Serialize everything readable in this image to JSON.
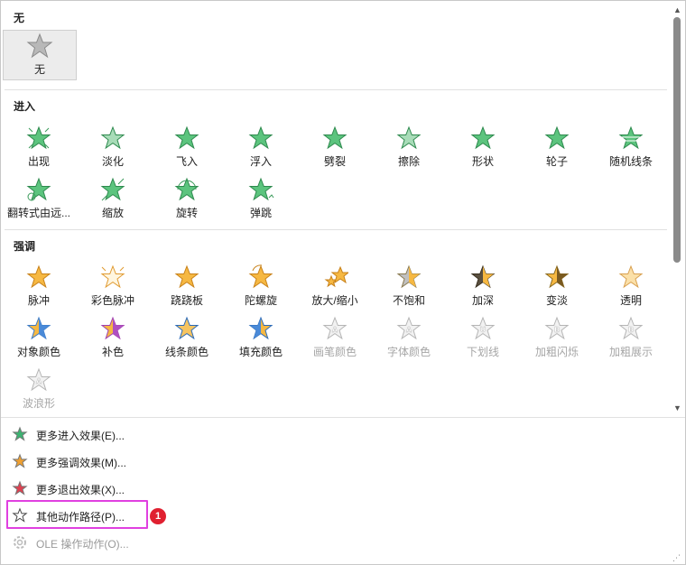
{
  "sections": {
    "none": "无",
    "entrance": "进入",
    "emphasis": "强调"
  },
  "none_item": {
    "label": "无",
    "icon": "star-gray-icon"
  },
  "entrance_items": [
    {
      "label": "出现",
      "icon": "appear-icon"
    },
    {
      "label": "淡化",
      "icon": "fade-icon"
    },
    {
      "label": "飞入",
      "icon": "fly-in-icon"
    },
    {
      "label": "浮入",
      "icon": "float-in-icon"
    },
    {
      "label": "劈裂",
      "icon": "split-icon"
    },
    {
      "label": "擦除",
      "icon": "wipe-icon"
    },
    {
      "label": "形状",
      "icon": "shape-icon"
    },
    {
      "label": "轮子",
      "icon": "wheel-icon"
    },
    {
      "label": "随机线条",
      "icon": "random-bars-icon"
    },
    {
      "label": "翻转式由远...",
      "icon": "grow-turn-icon"
    },
    {
      "label": "缩放",
      "icon": "zoom-icon"
    },
    {
      "label": "旋转",
      "icon": "swivel-icon"
    },
    {
      "label": "弹跳",
      "icon": "bounce-icon"
    }
  ],
  "emphasis_items": [
    {
      "label": "脉冲",
      "icon": "pulse-icon",
      "enabled": true
    },
    {
      "label": "彩色脉冲",
      "icon": "color-pulse-icon",
      "enabled": true
    },
    {
      "label": "跷跷板",
      "icon": "teeter-icon",
      "enabled": true
    },
    {
      "label": "陀螺旋",
      "icon": "spin-icon",
      "enabled": true
    },
    {
      "label": "放大/缩小",
      "icon": "grow-shrink-icon",
      "enabled": true
    },
    {
      "label": "不饱和",
      "icon": "desaturate-icon",
      "enabled": true
    },
    {
      "label": "加深",
      "icon": "darken-icon",
      "enabled": true
    },
    {
      "label": "变淡",
      "icon": "lighten-icon",
      "enabled": true
    },
    {
      "label": "透明",
      "icon": "transparency-icon",
      "enabled": true
    },
    {
      "label": "对象颜色",
      "icon": "object-color-icon",
      "enabled": true
    },
    {
      "label": "补色",
      "icon": "complementary-color-icon",
      "enabled": true
    },
    {
      "label": "线条颜色",
      "icon": "line-color-icon",
      "enabled": true
    },
    {
      "label": "填充颜色",
      "icon": "fill-color-icon",
      "enabled": true
    },
    {
      "label": "画笔颜色",
      "icon": "brush-color-icon",
      "enabled": false,
      "glyph": "A"
    },
    {
      "label": "字体颜色",
      "icon": "font-color-icon",
      "enabled": false,
      "glyph": "A"
    },
    {
      "label": "下划线",
      "icon": "underline-icon",
      "enabled": false,
      "glyph": "U"
    },
    {
      "label": "加粗闪烁",
      "icon": "bold-flash-icon",
      "enabled": false,
      "glyph": "B"
    },
    {
      "label": "加粗展示",
      "icon": "bold-reveal-icon",
      "enabled": false,
      "glyph": "B"
    },
    {
      "label": "波浪形",
      "icon": "wave-icon",
      "enabled": false,
      "glyph": "A"
    }
  ],
  "menu": [
    {
      "text": "更多进入效果(E)...",
      "icon": "entrance-star-icon",
      "color": "#3cb371",
      "enabled": true
    },
    {
      "text": "更多强调效果(M)...",
      "icon": "emphasis-star-icon",
      "color": "#f0a030",
      "enabled": true
    },
    {
      "text": "更多退出效果(X)...",
      "icon": "exit-star-icon",
      "color": "#e04050",
      "enabled": true
    },
    {
      "text": "其他动作路径(P)...",
      "icon": "motion-path-star-icon",
      "color": "#ffffff",
      "enabled": true
    },
    {
      "text": "OLE 操作动作(O)...",
      "icon": "gear-icon",
      "color": "#bbbbbb",
      "enabled": false
    }
  ],
  "badge": "1",
  "colors": {
    "green": "#3cb371",
    "orange": "#f0a030",
    "red": "#e04050",
    "highlight": "#e040e0"
  }
}
